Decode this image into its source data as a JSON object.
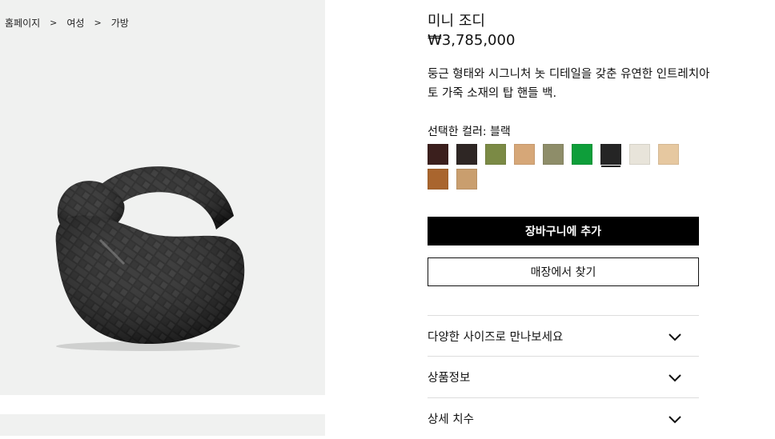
{
  "breadcrumb": {
    "items": [
      "홈페이지",
      "여성",
      "가방"
    ],
    "separator": ">"
  },
  "product": {
    "name": "미니 조디",
    "price": "₩3,785,000",
    "description": "둥근 형태와 시그니처 놋 디테일을 갖춘 유연한 인트레치아토 가죽 소재의 탑 핸들 백.",
    "color_label_prefix": "선택한 컬러:",
    "selected_color": "블랙"
  },
  "swatches": [
    {
      "name": "swatch-1",
      "color": "#3b1f1d",
      "selected": false
    },
    {
      "name": "swatch-2",
      "color": "#2e2624",
      "selected": false
    },
    {
      "name": "swatch-3",
      "color": "#7b8a45",
      "selected": false
    },
    {
      "name": "swatch-4",
      "color": "#d6a778",
      "selected": false
    },
    {
      "name": "swatch-5",
      "color": "#8e8d69",
      "selected": false
    },
    {
      "name": "swatch-6",
      "color": "#0e9e3a",
      "selected": false
    },
    {
      "name": "swatch-7",
      "color": "#252525",
      "selected": true
    },
    {
      "name": "swatch-8",
      "color": "#e8e4da",
      "selected": false
    },
    {
      "name": "swatch-9",
      "color": "#e6c8a0",
      "selected": false
    },
    {
      "name": "swatch-10",
      "color": "#a9652e",
      "selected": false
    },
    {
      "name": "swatch-11",
      "color": "#c99e6e",
      "selected": false
    }
  ],
  "buttons": {
    "add_to_cart": "장바구니에 추가",
    "find_in_store": "매장에서 찾기"
  },
  "accordion": [
    {
      "label": "다양한 사이즈로 만나보세요"
    },
    {
      "label": "상품정보"
    },
    {
      "label": "상세 치수"
    }
  ],
  "icons": {
    "chevron": "chevron-down-icon",
    "breadcrumb_sep": "chevron-right"
  },
  "colors": {
    "image_bg": "#f0f1f0",
    "primary_button": "#000000"
  }
}
